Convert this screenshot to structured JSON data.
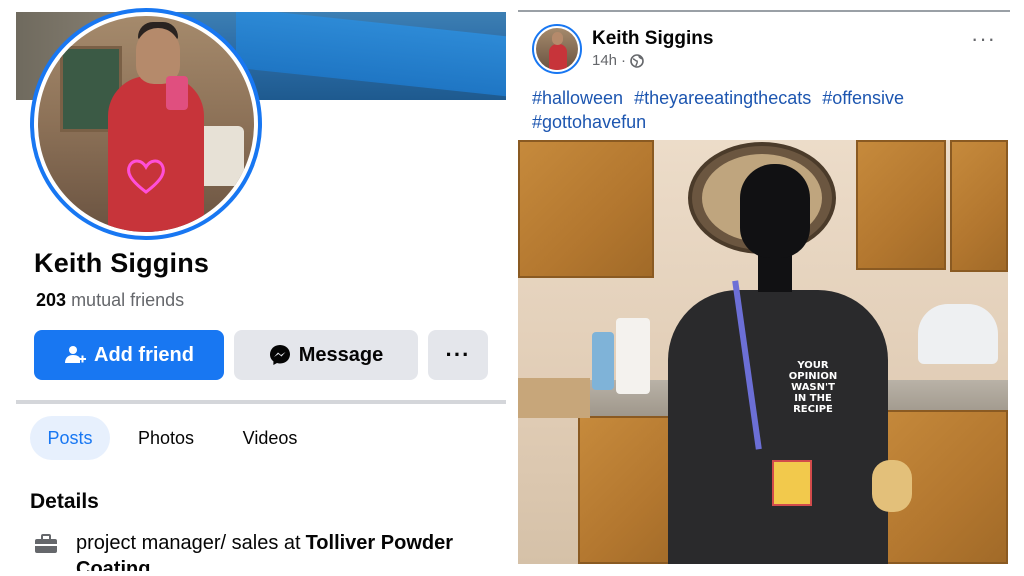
{
  "profile": {
    "name": "Keith Siggins",
    "mutual_count": "203",
    "mutual_label": "mutual friends",
    "add_friend_label": "Add friend",
    "message_label": "Message",
    "more_label": "···",
    "tabs": [
      "Posts",
      "Photos",
      "Videos"
    ],
    "details_heading": "Details",
    "job_text": "project manager/ sales at",
    "job_company": "Tolliver Powder",
    "job_company_cont": "Coating"
  },
  "post": {
    "author": "Keith Siggins",
    "time": "14h",
    "more_label": "···",
    "hashtags": [
      "#halloween",
      "#theyareeatingthecats",
      "#offensive",
      "#gottohavefun"
    ],
    "apron_text": "YOUR OPINION WASN'T IN THE RECIPE"
  },
  "colors": {
    "accent": "#1877f2",
    "button_gray": "#e4e6eb",
    "secondary_text": "#65676b",
    "hashtag": "#1d56b0"
  }
}
